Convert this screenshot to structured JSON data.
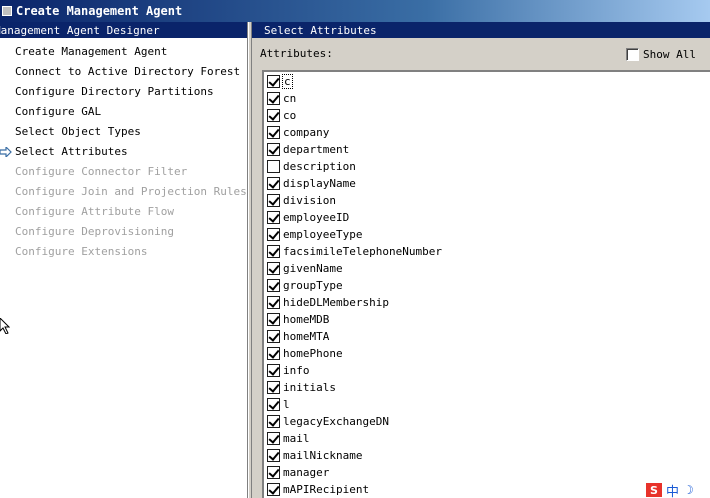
{
  "window": {
    "title": "Create Management Agent"
  },
  "left_pane": {
    "header": "Management Agent Designer",
    "steps": [
      {
        "label": "Create Management Agent",
        "enabled": true
      },
      {
        "label": "Connect to Active Directory Forest",
        "enabled": true
      },
      {
        "label": "Configure Directory Partitions",
        "enabled": true
      },
      {
        "label": "Configure GAL",
        "enabled": true
      },
      {
        "label": "Select Object Types",
        "enabled": true
      },
      {
        "label": "Select Attributes",
        "enabled": true,
        "current": true
      },
      {
        "label": "Configure Connector Filter",
        "enabled": false
      },
      {
        "label": "Configure Join and Projection Rules",
        "enabled": false
      },
      {
        "label": "Configure Attribute Flow",
        "enabled": false
      },
      {
        "label": "Configure Deprovisioning",
        "enabled": false
      },
      {
        "label": "Configure Extensions",
        "enabled": false
      }
    ]
  },
  "right_pane": {
    "header": "Select Attributes",
    "attributes_label": "Attributes:",
    "show_all_label": "Show All",
    "show_all_checked": false,
    "attributes": [
      {
        "name": "c",
        "checked": true
      },
      {
        "name": "cn",
        "checked": true
      },
      {
        "name": "co",
        "checked": true
      },
      {
        "name": "company",
        "checked": true
      },
      {
        "name": "department",
        "checked": true
      },
      {
        "name": "description",
        "checked": false
      },
      {
        "name": "displayName",
        "checked": true
      },
      {
        "name": "division",
        "checked": true
      },
      {
        "name": "employeeID",
        "checked": true
      },
      {
        "name": "employeeType",
        "checked": true
      },
      {
        "name": "facsimileTelephoneNumber",
        "checked": true
      },
      {
        "name": "givenName",
        "checked": true
      },
      {
        "name": "groupType",
        "checked": true
      },
      {
        "name": "hideDLMembership",
        "checked": true
      },
      {
        "name": "homeMDB",
        "checked": true
      },
      {
        "name": "homeMTA",
        "checked": true
      },
      {
        "name": "homePhone",
        "checked": true
      },
      {
        "name": "info",
        "checked": true
      },
      {
        "name": "initials",
        "checked": true
      },
      {
        "name": "l",
        "checked": true
      },
      {
        "name": "legacyExchangeDN",
        "checked": true
      },
      {
        "name": "mail",
        "checked": true
      },
      {
        "name": "mailNickname",
        "checked": true
      },
      {
        "name": "manager",
        "checked": true
      },
      {
        "name": "mAPIRecipient",
        "checked": true
      }
    ]
  },
  "tray": {
    "ime_s": "S",
    "ime_lang": "中",
    "ime_moon": "☽"
  },
  "colors": {
    "header_bg": "#0a246a",
    "disabled_text": "#a0a0a0"
  }
}
